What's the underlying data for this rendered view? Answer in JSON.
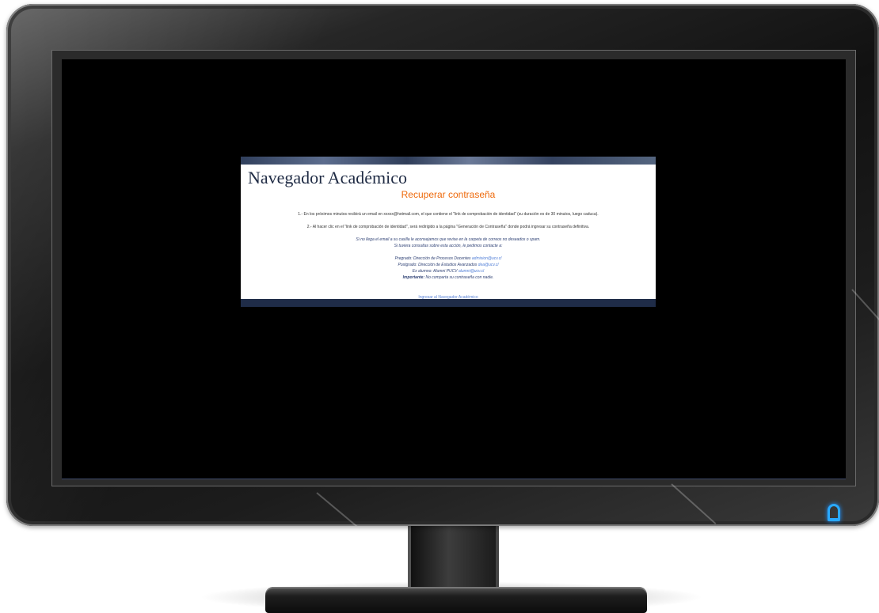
{
  "site": {
    "title": "Navegador Académico",
    "heading": "Recuperar contraseña"
  },
  "content": {
    "step1": "1.- En los próximos minutos recibirá un email en xxxxx@hotmail.com, el que contiene el \"link de comprobación de identidad\" (su duración es de 30 minutos, luego caduca).",
    "step2": "2.- Al hacer clic en el \"link de comprobación de identidad\", será redirigido a la página \"Generación de Contraseña\" donde podrá ingresar su contraseña definitiva.",
    "spam_note": "Si no llega el email a su casilla le aconsejamos que revise en la carpeta de correos no deseados o spam.",
    "contact_intro": "Si tuviera consultas sobre esta acción, le pedimos contacte a:",
    "contacts": [
      {
        "label": "Pregrado: Dirección de Procesos Docentes",
        "email": "admision@ucv.cl"
      },
      {
        "label": "Postgrado: Dirección de Estudios Avanzados",
        "email": "dea@ucv.cl"
      },
      {
        "label": "Ex alumno: Alumni PUCV",
        "email": "alumni@ucv.cl"
      }
    ],
    "important_label": "Importante:",
    "important_text": "No comparta su contraseña con nadie."
  },
  "footer": {
    "link_label": "Ingresar al Navegador Académico"
  },
  "colors": {
    "heading": "#ee6a0c",
    "header_bar": "#31405d",
    "link": "#4d7cd6",
    "power_led": "#29a9ff"
  },
  "icons": {
    "power": "power-led-icon"
  }
}
